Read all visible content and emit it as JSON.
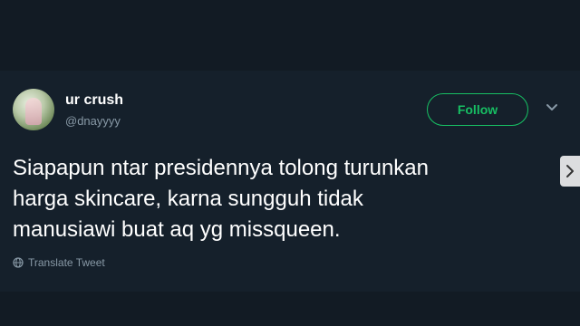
{
  "tweet": {
    "display_name": "ur crush",
    "handle": "@dnayyyy",
    "follow_label": "Follow",
    "text": "Siapapun ntar presidennya tolong turunkan\nharga skincare, karna sungguh tidak\nmanusiawi buat aq yg missqueen.",
    "translate_label": "Translate Tweet"
  },
  "icons": {
    "menu": "chevron-down-icon",
    "translate": "globe-icon",
    "next": "chevron-right-icon"
  },
  "colors": {
    "background": "#15202b",
    "accent": "#17bf63",
    "secondary_text": "#8899a6"
  }
}
